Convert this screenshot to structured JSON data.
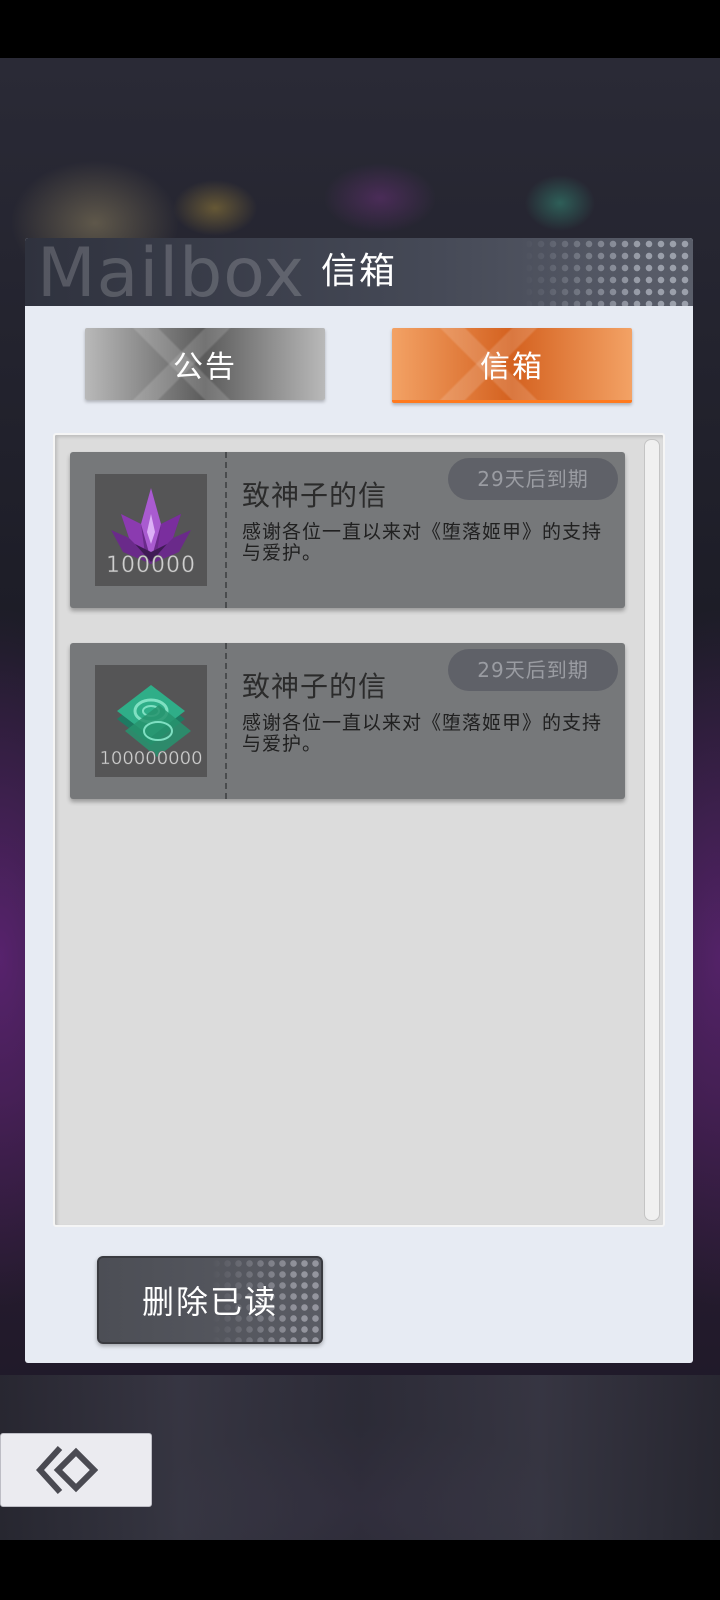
{
  "mailbox": {
    "header_deco": "Mailbox",
    "title": "信箱",
    "tabs": [
      {
        "label": "公告",
        "active": false
      },
      {
        "label": "信箱",
        "active": true
      }
    ],
    "mails": [
      {
        "title": "致神子的信",
        "body": "感谢各位一直以来对《堕落姬甲》的支持与爱护。",
        "expire": "29天后到期",
        "item": {
          "icon": "purple-crystal-icon",
          "count": "100000"
        }
      },
      {
        "title": "致神子的信",
        "body": "感谢各位一直以来对《堕落姬甲》的支持与爱护。",
        "expire": "29天后到期",
        "item": {
          "icon": "green-ticket-icon",
          "count": "100000000"
        }
      }
    ],
    "delete_read_label": "删除已读"
  },
  "back_button": {
    "icon": "back-diamond-icon"
  },
  "colors": {
    "active_tab": "#d4611f",
    "inactive_tab": "#5b5b5b",
    "header_bg": "#2f323e",
    "panel_bg": "#e7ebf3",
    "mail_bg": "#76787a"
  }
}
